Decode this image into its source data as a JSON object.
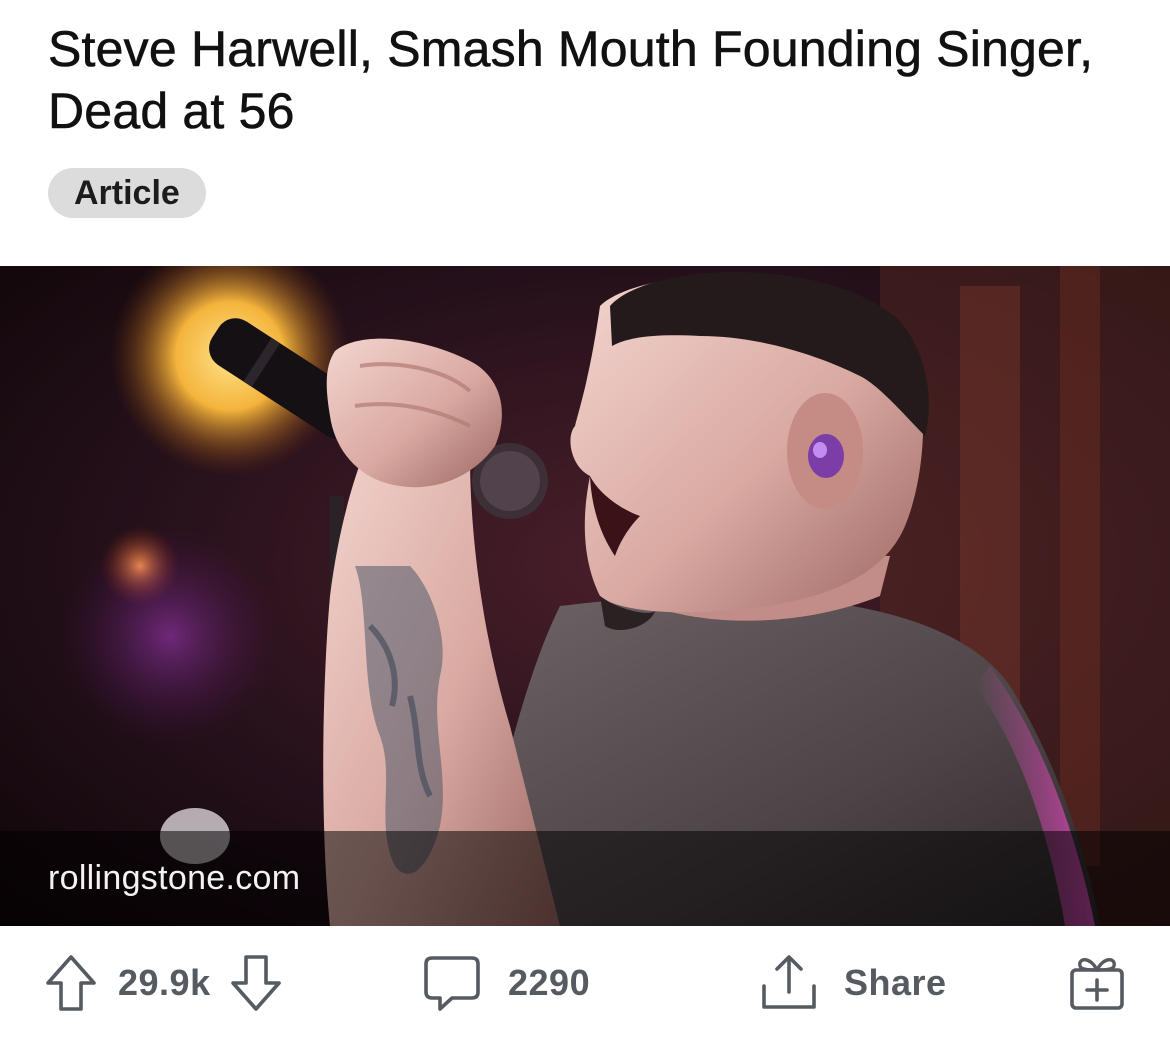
{
  "post": {
    "title": "Steve Harwell, Smash Mouth Founding Singer, Dead at 56",
    "flair": "Article",
    "domain": "rollingstone.com",
    "image_alt": "Steve Harwell singing into a microphone on stage"
  },
  "actions": {
    "upvote_icon": "arrow-up-icon",
    "score": "29.9k",
    "downvote_icon": "arrow-down-icon",
    "comment_icon": "speech-bubble-icon",
    "comments": "2290",
    "share_icon": "share-upload-icon",
    "share_label": "Share",
    "award_icon": "gift-plus-icon"
  },
  "colors": {
    "flair_bg": "#dcdcdc",
    "icon_gray": "#555b60",
    "link_bar": "rgba(0,0,0,0.52)"
  }
}
